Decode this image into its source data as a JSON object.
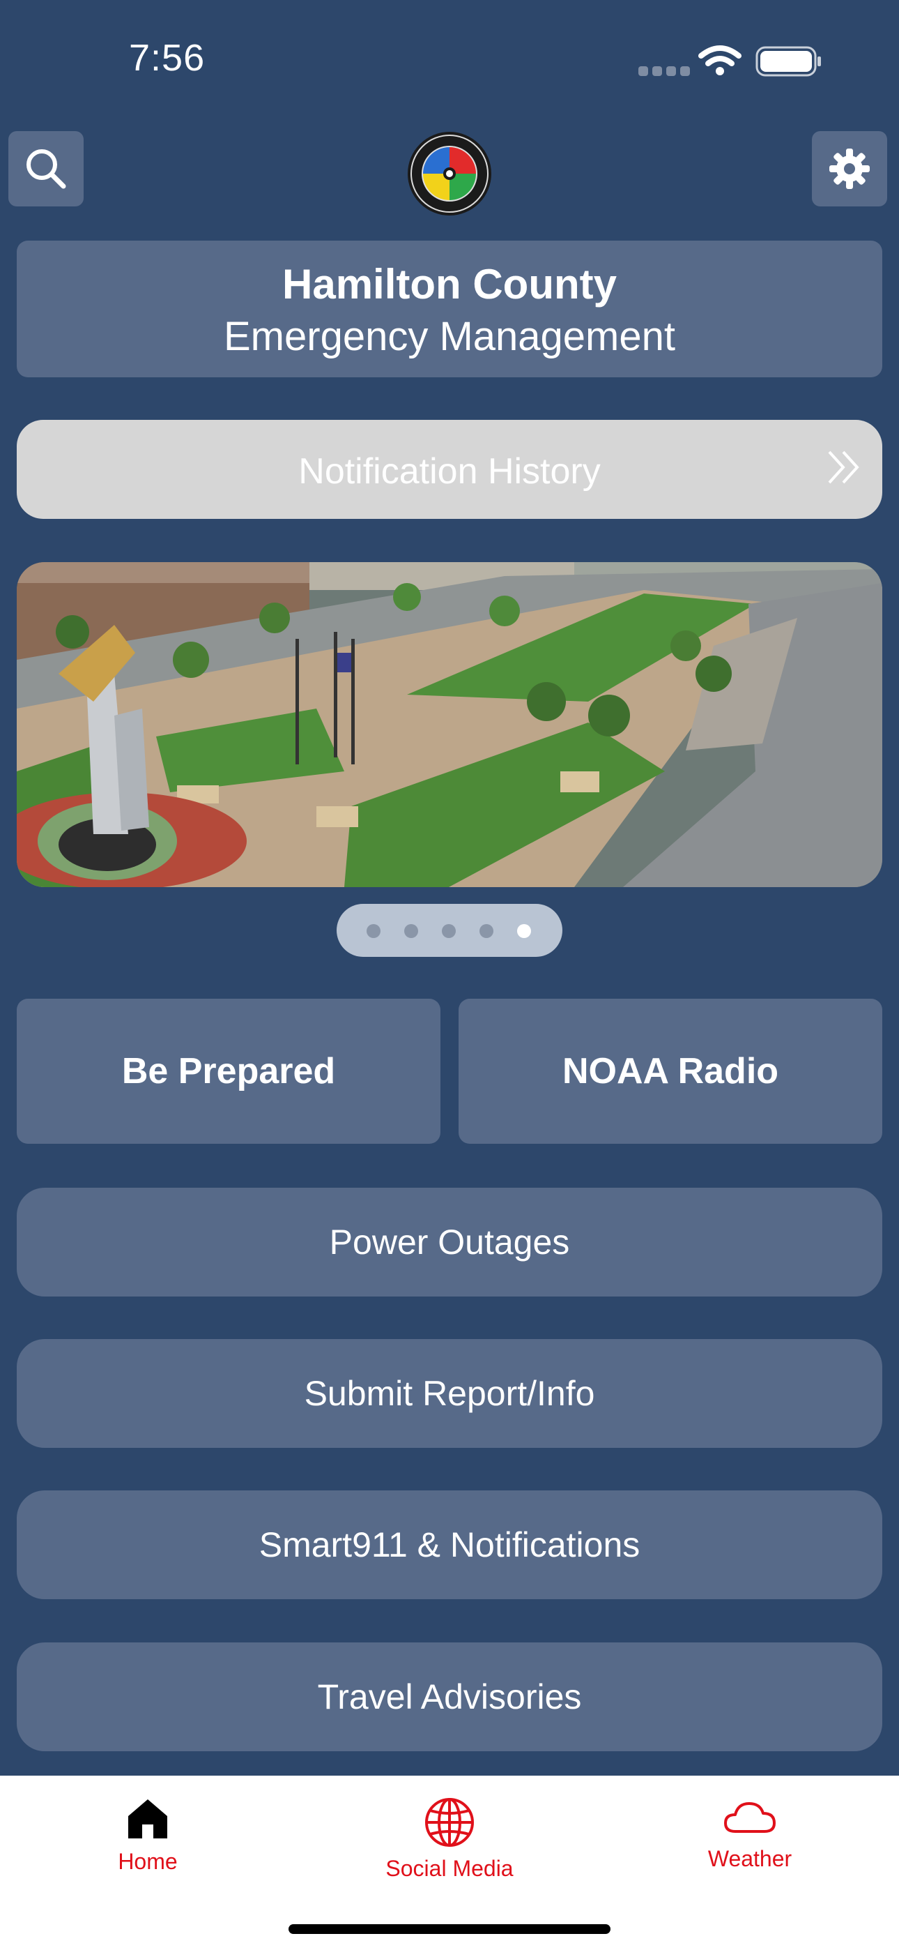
{
  "status_bar": {
    "time": "7:56"
  },
  "header": {
    "search_icon": "search-icon",
    "settings_icon": "gear-icon",
    "title_line1": "Hamilton County",
    "title_line2": "Emergency Management"
  },
  "notification": {
    "label": "Notification History"
  },
  "carousel": {
    "page_count": 5,
    "active_index": 4
  },
  "buttons": {
    "be_prepared": "Be Prepared",
    "noaa_radio": "NOAA Radio",
    "power_outages": "Power Outages",
    "submit_report": "Submit Report/Info",
    "smart911": "Smart911 & Notifications",
    "travel_advisories": "Travel Advisories"
  },
  "tabs": [
    {
      "label": "Home",
      "icon": "home-icon"
    },
    {
      "label": "Social Media",
      "icon": "globe-icon"
    },
    {
      "label": "Weather",
      "icon": "cloud-icon"
    }
  ],
  "colors": {
    "background": "#2d476b",
    "button": "#576a89",
    "tab_accent": "#e0101a"
  }
}
